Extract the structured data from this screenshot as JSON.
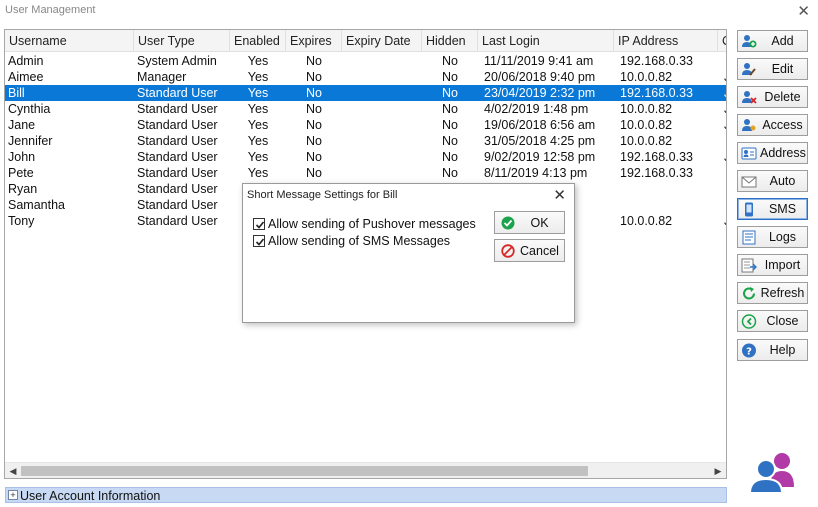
{
  "window": {
    "title": "User Management",
    "close_glyph": "✕"
  },
  "grid": {
    "columns": [
      "Username",
      "User Type",
      "Enabled",
      "Expires",
      "Expiry Date",
      "Hidden",
      "Last Login",
      "IP Address",
      "C"
    ],
    "rows": [
      {
        "username": "Admin",
        "user_type": "System Admin",
        "enabled": "Yes",
        "expires": "No",
        "expiry_date": "",
        "hidden": "No",
        "last_login": "11/11/2019 9:41 am",
        "ip": "192.168.0.33",
        "extra": ""
      },
      {
        "username": "Aimee",
        "user_type": "Manager",
        "enabled": "Yes",
        "expires": "No",
        "expiry_date": "",
        "hidden": "No",
        "last_login": "20/06/2018 9:40 pm",
        "ip": "10.0.0.82",
        "extra": "JU"
      },
      {
        "username": "Bill",
        "user_type": "Standard User",
        "enabled": "Yes",
        "expires": "No",
        "expiry_date": "",
        "hidden": "No",
        "last_login": "23/04/2019 2:32 pm",
        "ip": "192.168.0.33",
        "extra": "JU",
        "selected": true
      },
      {
        "username": "Cynthia",
        "user_type": "Standard User",
        "enabled": "Yes",
        "expires": "No",
        "expiry_date": "",
        "hidden": "No",
        "last_login": "4/02/2019 1:48 pm",
        "ip": "10.0.0.82",
        "extra": "JU"
      },
      {
        "username": "Jane",
        "user_type": "Standard User",
        "enabled": "Yes",
        "expires": "No",
        "expiry_date": "",
        "hidden": "No",
        "last_login": "19/06/2018 6:56 am",
        "ip": "10.0.0.82",
        "extra": "JU"
      },
      {
        "username": "Jennifer",
        "user_type": "Standard User",
        "enabled": "Yes",
        "expires": "No",
        "expiry_date": "",
        "hidden": "No",
        "last_login": "31/05/2018 4:25 pm",
        "ip": "10.0.0.82",
        "extra": ""
      },
      {
        "username": "John",
        "user_type": "Standard User",
        "enabled": "Yes",
        "expires": "No",
        "expiry_date": "",
        "hidden": "No",
        "last_login": "9/02/2019 12:58 pm",
        "ip": "192.168.0.33",
        "extra": "JU"
      },
      {
        "username": "Pete",
        "user_type": "Standard User",
        "enabled": "Yes",
        "expires": "No",
        "expiry_date": "",
        "hidden": "No",
        "last_login": "8/11/2019 4:13 pm",
        "ip": "192.168.0.33",
        "extra": ""
      },
      {
        "username": "Ryan",
        "user_type": "Standard User",
        "enabled": "",
        "expires": "",
        "expiry_date": "",
        "hidden": "",
        "last_login": "",
        "ip": "",
        "extra": ""
      },
      {
        "username": "Samantha",
        "user_type": "Standard User",
        "enabled": "",
        "expires": "",
        "expiry_date": "",
        "hidden": "",
        "last_login": "",
        "ip": "",
        "extra": ""
      },
      {
        "username": "Tony",
        "user_type": "Standard User",
        "enabled": "",
        "expires": "",
        "expiry_date": "",
        "hidden": "",
        "last_login": "",
        "ip": "10.0.0.82",
        "extra": "JU"
      }
    ]
  },
  "buttons": [
    {
      "label": "Add",
      "icon": "user-add-icon"
    },
    {
      "label": "Edit",
      "icon": "user-edit-icon"
    },
    {
      "label": "Delete",
      "icon": "user-delete-icon"
    },
    {
      "label": "Access",
      "icon": "user-access-icon"
    },
    {
      "label": "Address",
      "icon": "address-card-icon"
    },
    {
      "label": "Auto",
      "icon": "envelope-icon"
    },
    {
      "label": "SMS",
      "icon": "phone-icon",
      "active": true
    },
    {
      "label": "Logs",
      "icon": "logs-icon"
    },
    {
      "label": "Import",
      "icon": "import-icon"
    },
    {
      "label": "Refresh",
      "icon": "refresh-icon"
    },
    {
      "label": "Close",
      "icon": "close-circle-icon"
    },
    {
      "label": "Help",
      "icon": "help-icon"
    }
  ],
  "info_bar": {
    "expander": "+",
    "label": "User Account Information"
  },
  "dialog": {
    "title": "Short Message Settings for Bill",
    "close_glyph": "✕",
    "options": [
      {
        "label": "Allow sending of Pushover messages",
        "checked": true
      },
      {
        "label": "Allow sending of SMS Messages",
        "checked": true
      }
    ],
    "ok_label": "OK",
    "cancel_label": "Cancel"
  },
  "colors": {
    "selection": "#0a78d7",
    "info_bar": "#c8daf3",
    "ok_icon": "#1aa34a",
    "cancel_icon": "#d62828",
    "avatar_male": "#2f72c4",
    "avatar_female": "#b13aa6"
  }
}
